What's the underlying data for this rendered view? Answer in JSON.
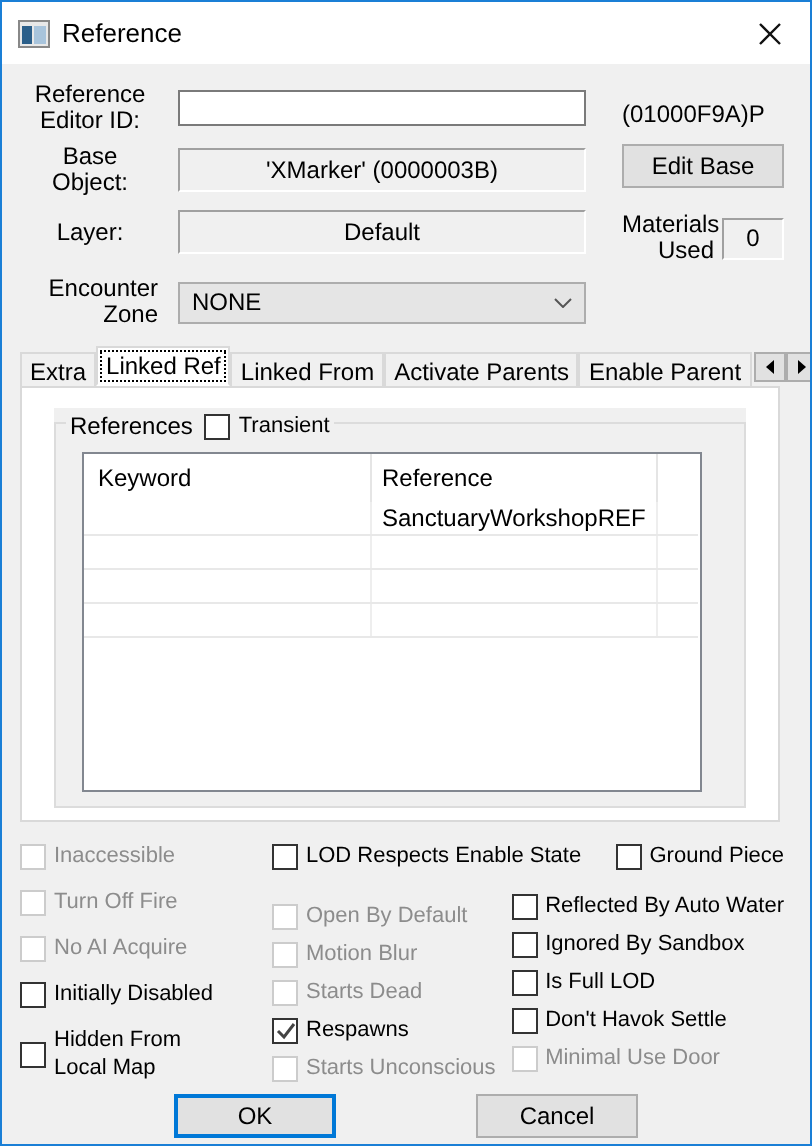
{
  "window": {
    "title": "Reference"
  },
  "fields": {
    "editor_id": {
      "label": "Reference Editor ID:"
    },
    "base_object": {
      "label": "Base Object:",
      "value": "'XMarker' (0000003B)"
    },
    "layer": {
      "label": "Layer:",
      "value": "Default"
    },
    "encounter_zone": {
      "label": "Encounter Zone",
      "value": "NONE"
    }
  },
  "form_id": "(01000F9A)P",
  "edit_base_button": "Edit Base",
  "materials_used": {
    "label": "Materials Used",
    "value": "0"
  },
  "tabs": [
    {
      "label": "Extra",
      "selected": false
    },
    {
      "label": "Linked Ref",
      "selected": true
    },
    {
      "label": "Linked From",
      "selected": false
    },
    {
      "label": "Activate Parents",
      "selected": false
    },
    {
      "label": "Enable Parent",
      "selected": false
    }
  ],
  "references": {
    "title": "References",
    "transient": {
      "label": "Transient",
      "checked": false
    },
    "columns": [
      "Keyword",
      "Reference"
    ],
    "rows": [
      {
        "reference": "SanctuaryWorkshopREF"
      }
    ]
  },
  "flags_left": [
    {
      "label": "Inaccessible",
      "checked": false,
      "disabled": true
    },
    {
      "label": "Turn Off Fire",
      "checked": false,
      "disabled": true
    },
    {
      "label": "No AI Acquire",
      "checked": false,
      "disabled": true
    },
    {
      "label": "Initially Disabled",
      "checked": false,
      "disabled": false
    },
    {
      "label": "Hidden From Local Map",
      "checked": false,
      "disabled": false
    }
  ],
  "flags_top": [
    {
      "label": "LOD Respects Enable State",
      "checked": false,
      "disabled": false
    },
    {
      "label": "Ground Piece",
      "checked": false,
      "disabled": false
    }
  ],
  "flags_middle": [
    {
      "label": "Open By Default",
      "checked": false,
      "disabled": true
    },
    {
      "label": "Motion Blur",
      "checked": false,
      "disabled": true
    },
    {
      "label": "Starts Dead",
      "checked": false,
      "disabled": true
    },
    {
      "label": "Respawns",
      "checked": true,
      "disabled": false
    },
    {
      "label": "Starts Unconscious",
      "checked": false,
      "disabled": true
    }
  ],
  "flags_right": [
    {
      "label": "Reflected By Auto Water",
      "checked": false,
      "disabled": false
    },
    {
      "label": "Ignored By Sandbox",
      "checked": false,
      "disabled": false
    },
    {
      "label": "Is Full LOD",
      "checked": false,
      "disabled": false
    },
    {
      "label": "Don't Havok Settle",
      "checked": false,
      "disabled": false
    },
    {
      "label": "Minimal Use Door",
      "checked": false,
      "disabled": true
    }
  ],
  "buttons": [
    {
      "label": "OK",
      "default": true
    },
    {
      "label": "Cancel",
      "default": false
    }
  ]
}
